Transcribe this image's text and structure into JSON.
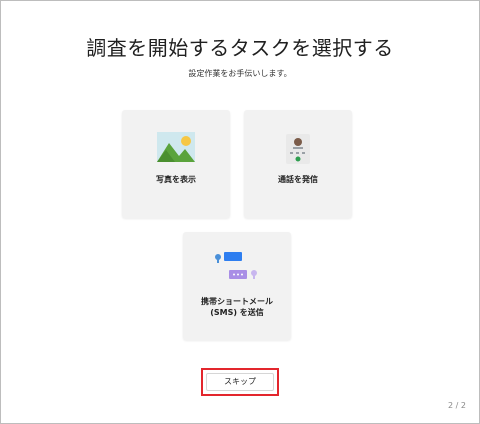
{
  "header": {
    "title": "調査を開始するタスクを選択する",
    "subtitle": "設定作業をお手伝いします。"
  },
  "tasks": [
    {
      "label": "写真を表示",
      "icon": "photo-icon"
    },
    {
      "label": "通話を発信",
      "icon": "phone-call-icon"
    },
    {
      "label_line1": "携帯ショートメール",
      "label_line2": "(SMS) を送信",
      "icon": "sms-icon"
    }
  ],
  "footer": {
    "skip_label": "スキップ",
    "pager": "2 / 2"
  },
  "colors": {
    "highlight_border": "#e3262d",
    "card_background": "#f2f2f2",
    "sms_blue": "#2e7ef0",
    "sms_purple": "#a98ee6"
  }
}
